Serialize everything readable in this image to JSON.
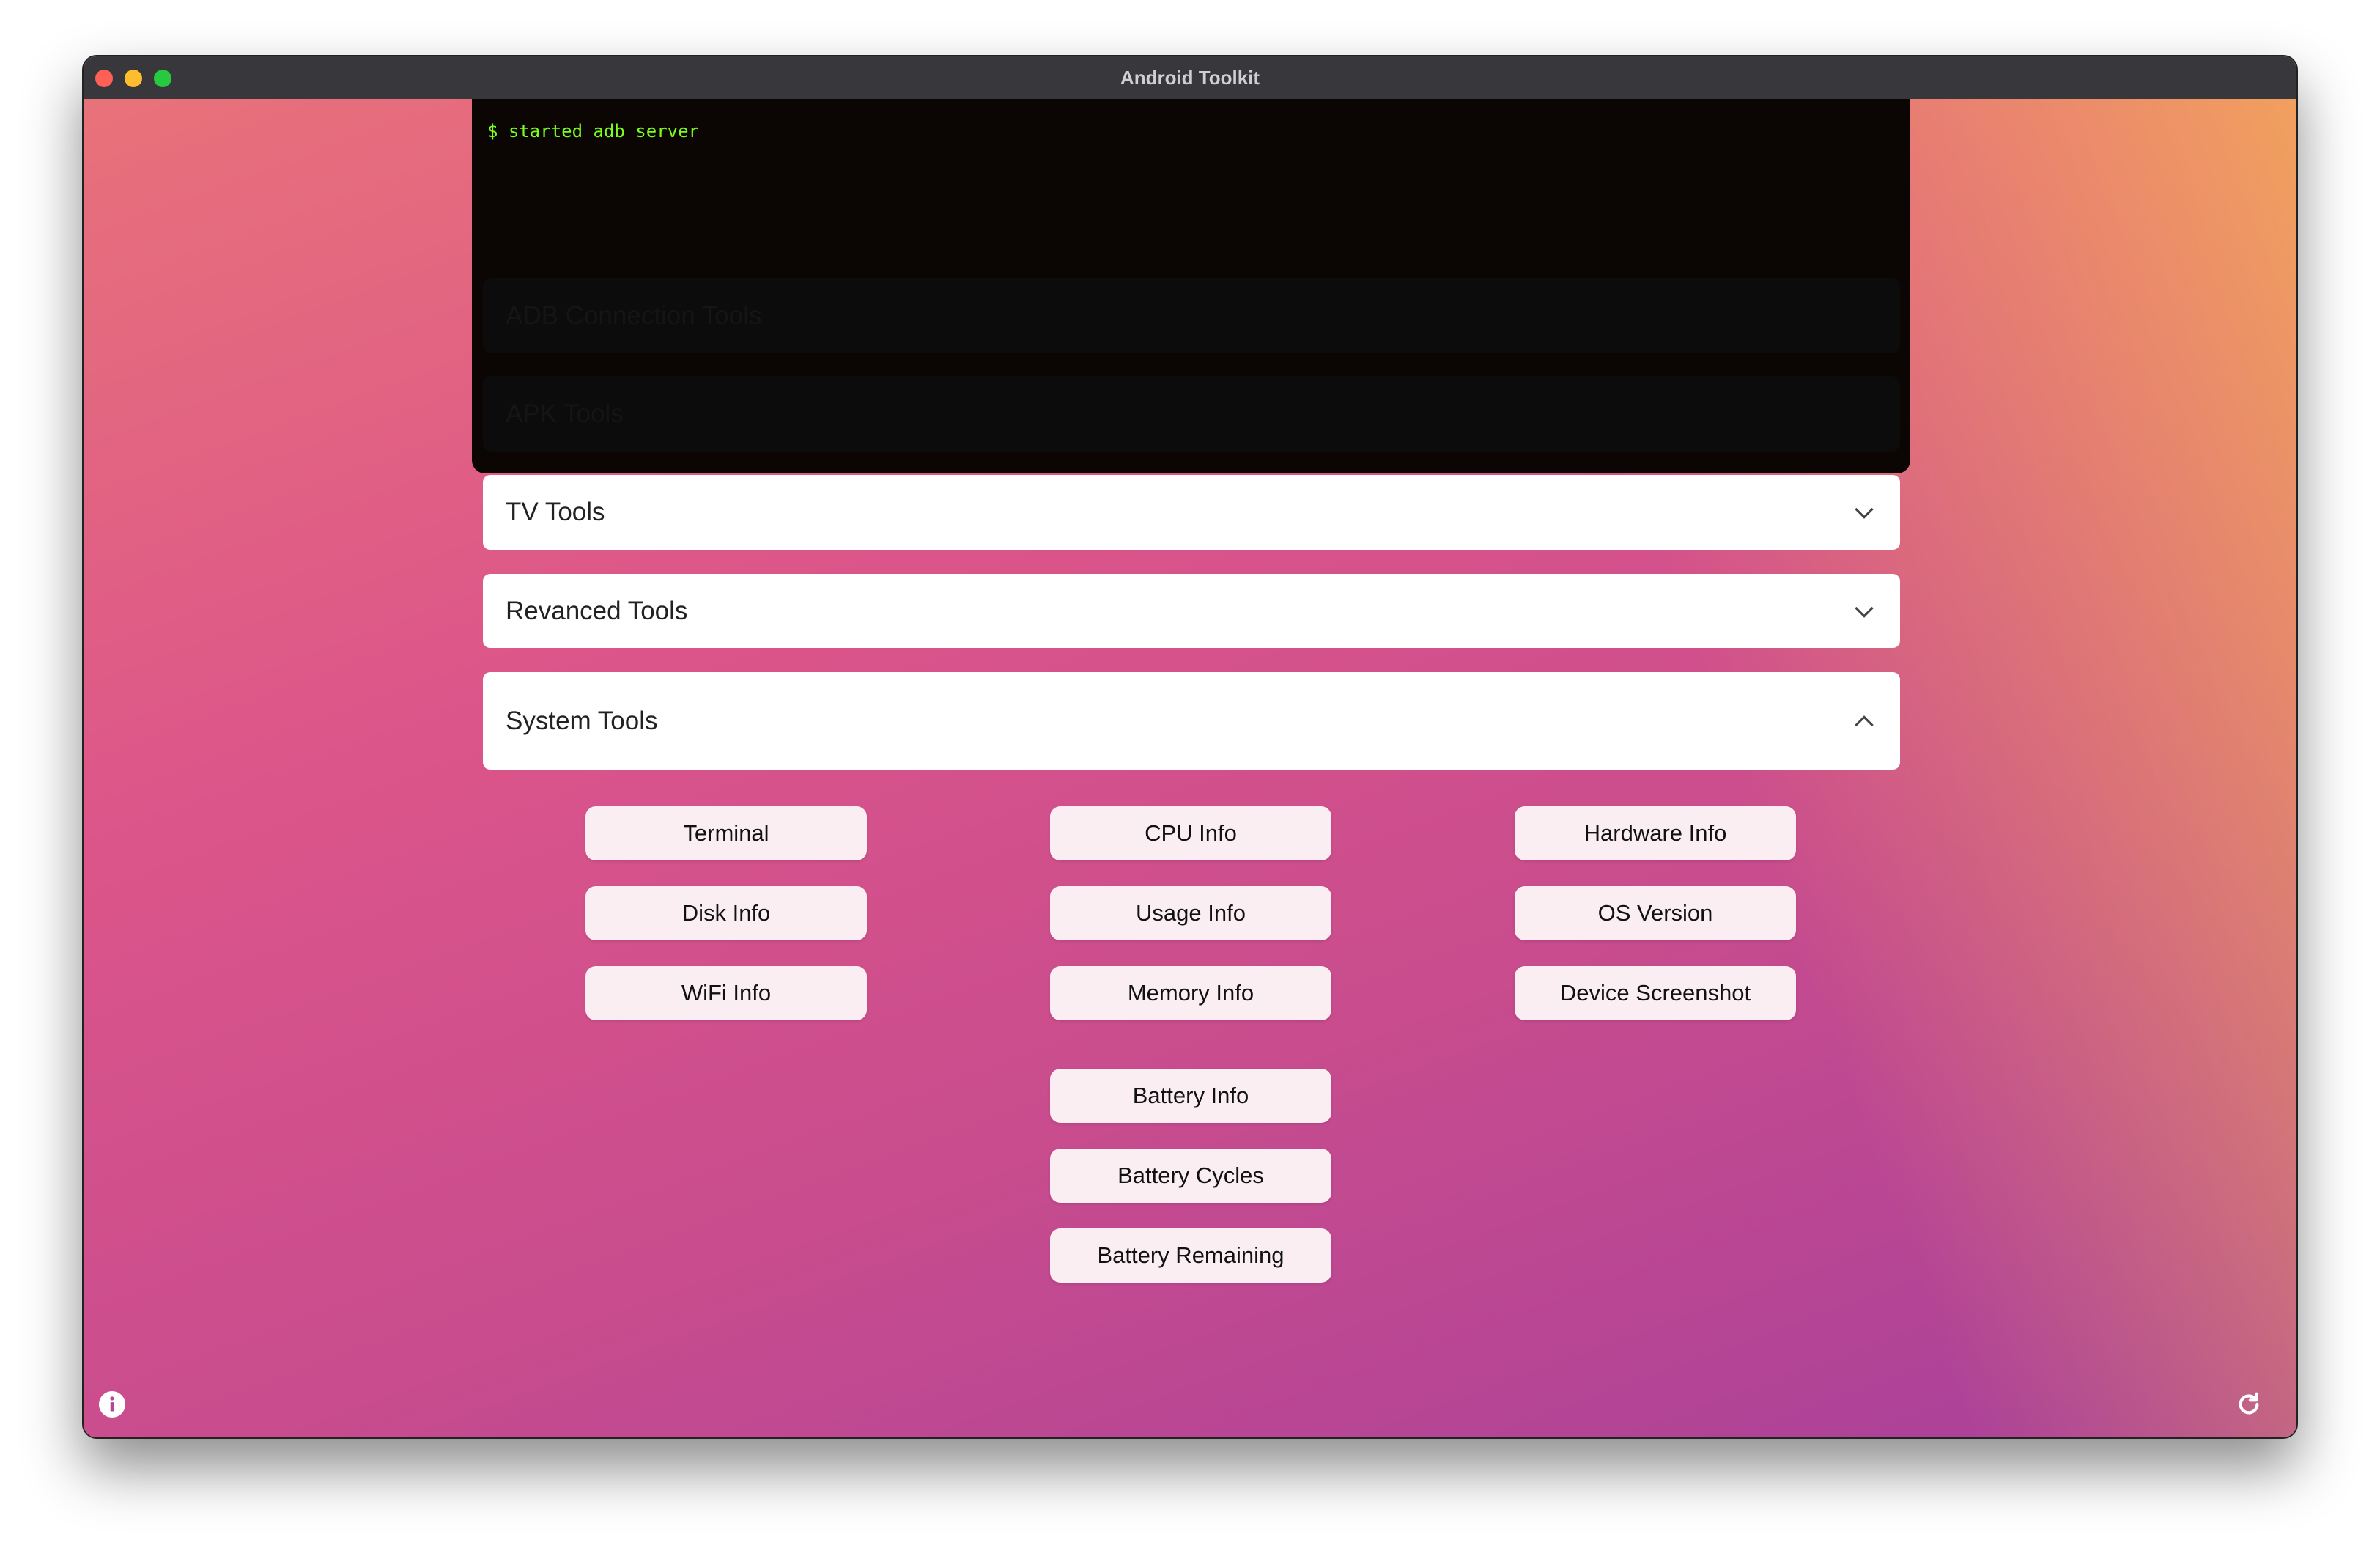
{
  "window": {
    "title": "Android Toolkit"
  },
  "terminal": {
    "output": "$ started adb server"
  },
  "sections": [
    {
      "label": "ADB Connection Tools",
      "expanded": false
    },
    {
      "label": "APK Tools",
      "expanded": false
    },
    {
      "label": "TV Tools",
      "expanded": false
    },
    {
      "label": "Revanced Tools",
      "expanded": false
    },
    {
      "label": "System Tools",
      "expanded": true
    }
  ],
  "system_tools": {
    "buttons": [
      "Terminal",
      "CPU Info",
      "Hardware Info",
      "Disk Info",
      "Usage Info",
      "OS Version",
      "WiFi Info",
      "Memory Info",
      "Device Screenshot",
      "Battery Info",
      "Battery Cycles",
      "Battery Remaining"
    ]
  },
  "icons": {
    "info": "info-icon",
    "refresh": "refresh-icon"
  }
}
